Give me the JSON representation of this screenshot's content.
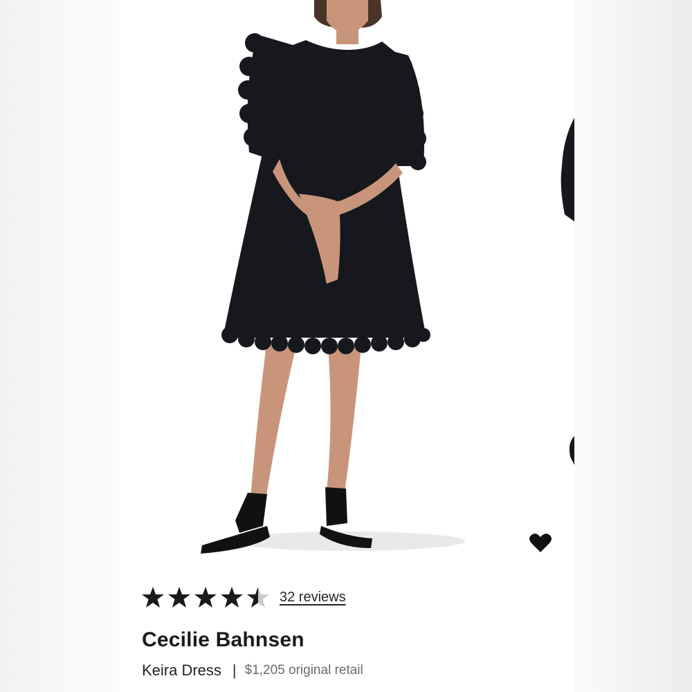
{
  "colors": {
    "dress": "#16181e",
    "skin": "#c9957a",
    "hair": "#4a3427",
    "star_fill": "#1a1a1a",
    "star_empty": "#c8c8c8"
  },
  "icons": {
    "favorite": "heart-icon",
    "rating": "star-icon"
  },
  "rating": {
    "value": 4.5,
    "max": 5,
    "reviews_label": "32 reviews"
  },
  "product": {
    "designer": "Cecilie Bahnsen",
    "name": "Keira Dress",
    "separator": "|",
    "retail_price": "$1,205 original retail"
  }
}
